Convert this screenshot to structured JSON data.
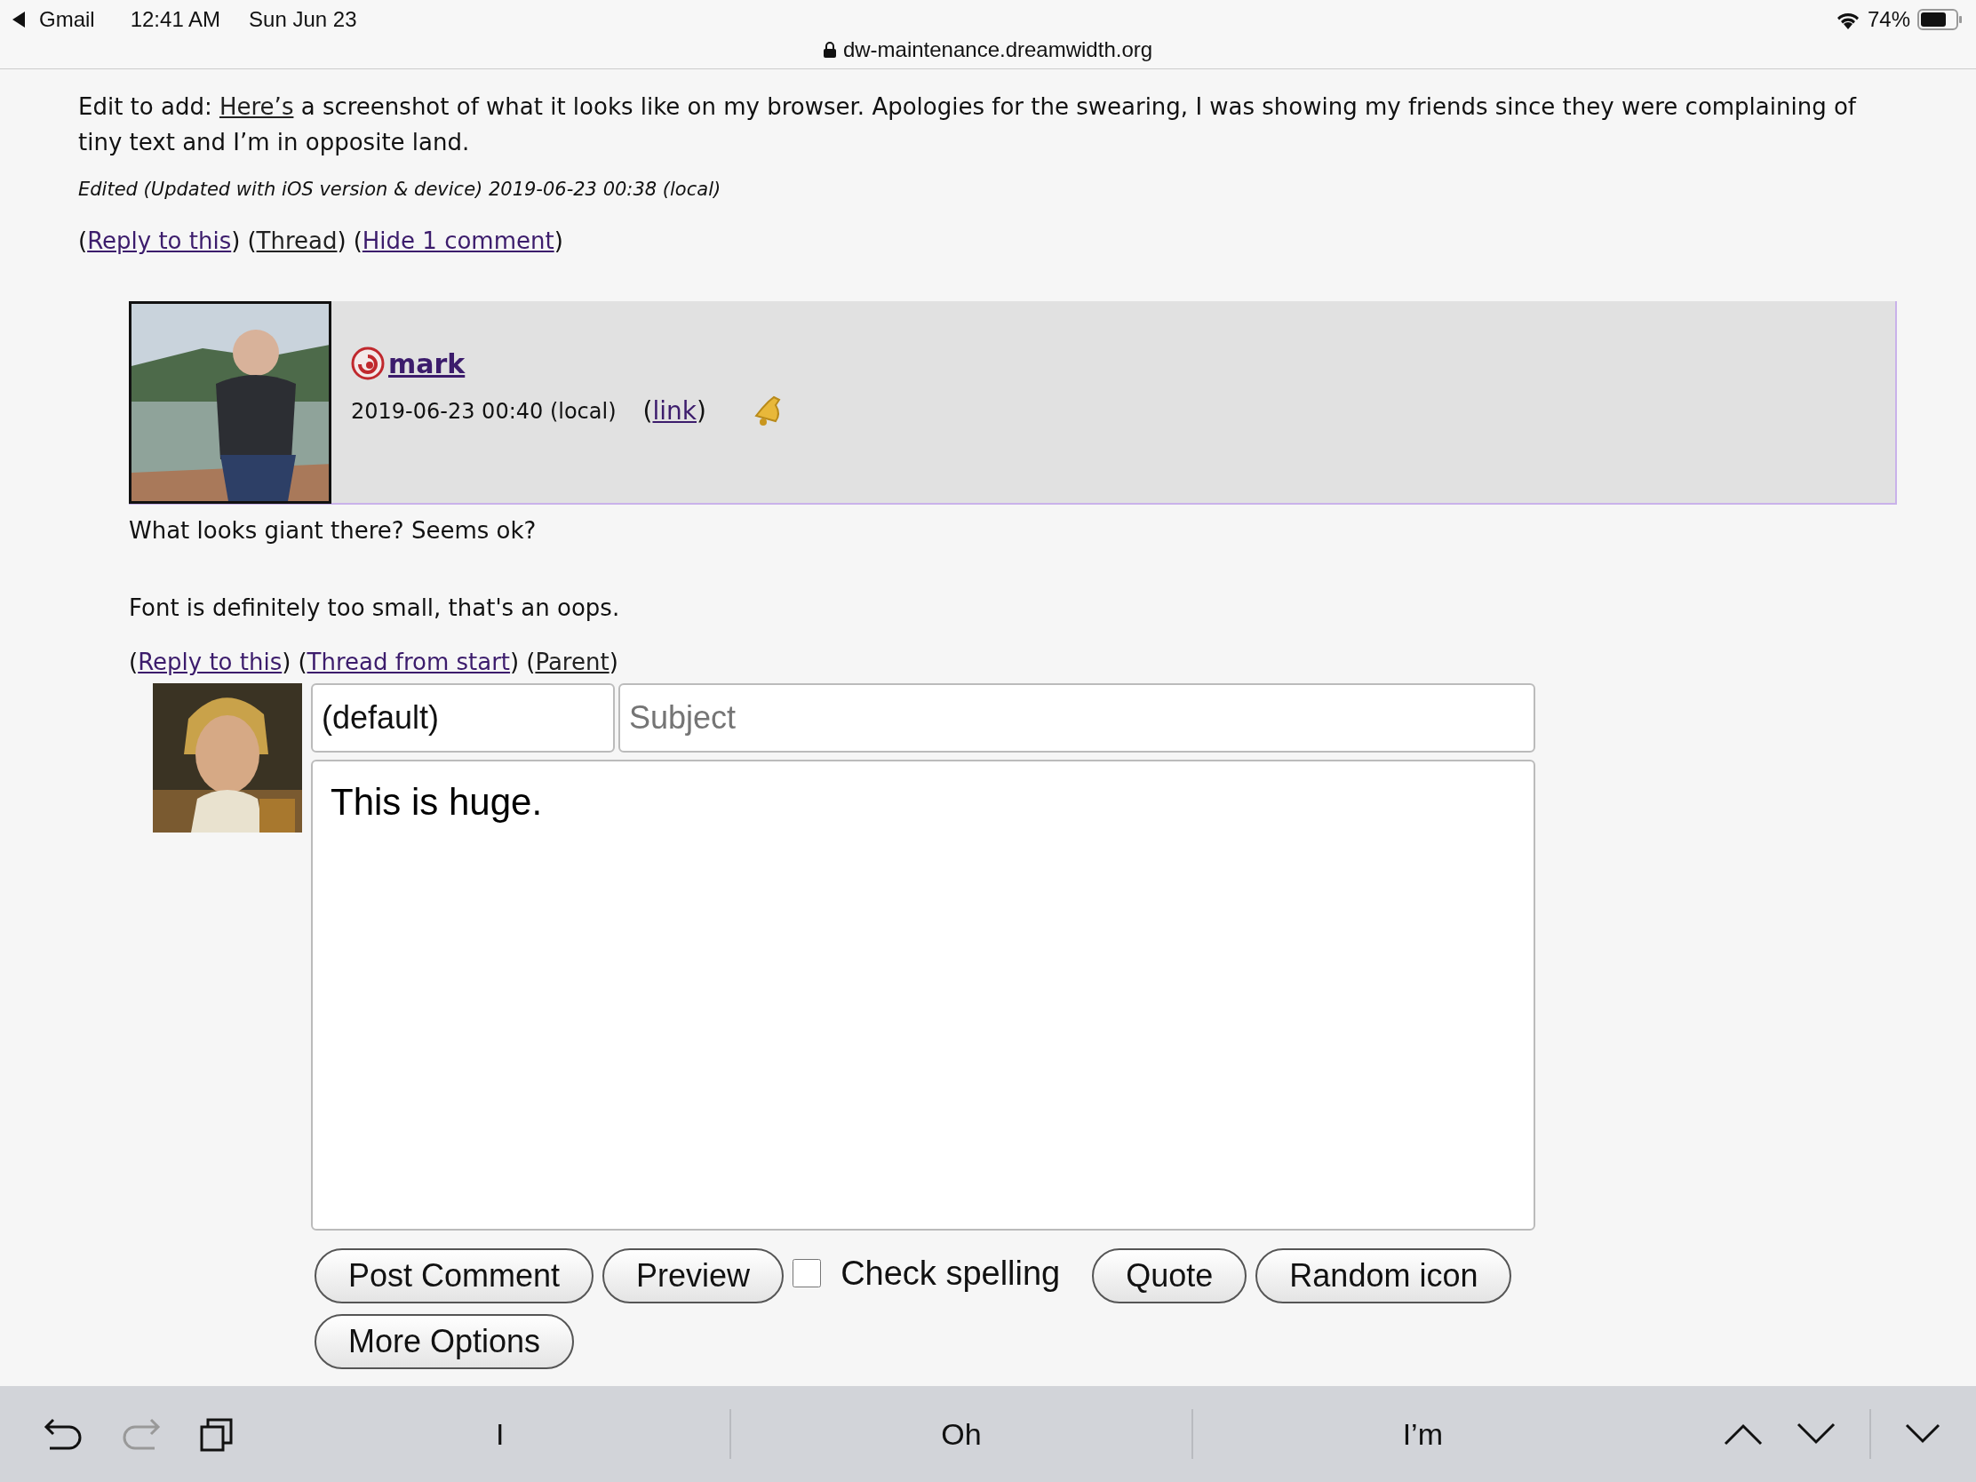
{
  "status_bar": {
    "back_app": "Gmail",
    "time": "12:41 AM",
    "date": "Sun Jun 23",
    "url": "dw-maintenance.dreamwidth.org",
    "battery": "74%"
  },
  "post": {
    "edit_note": {
      "before": "Edit to add: ",
      "link": "Here’s",
      "after": " a screenshot of what it looks like on my browser. Apologies for the swearing, I was showing my friends since they were complaining of tiny text and I’m in opposite land."
    },
    "edited": "Edited (Updated with iOS version & device) 2019-06-23 00:38 (local)",
    "actions": [
      {
        "before": "(",
        "label": "Reply to this",
        "after": ")",
        "visited": false
      },
      {
        "before": "(",
        "label": "Thread",
        "after": ")",
        "visited": true
      },
      {
        "before": "(",
        "label": "Hide 1 comment",
        "after": ")",
        "visited": false
      }
    ]
  },
  "comment": {
    "username": "mark",
    "timestamp": "2019-06-23 00:40 (local)",
    "link": {
      "before": "(",
      "label": "link",
      "after": ")"
    },
    "body": [
      "What looks giant there? Seems ok?",
      "Font is definitely too small, that's an oops."
    ],
    "actions": [
      {
        "before": "(",
        "label": "Reply to this",
        "after": ")",
        "visited": false
      },
      {
        "before": "(",
        "label": "Thread from start",
        "after": ")",
        "visited": false
      },
      {
        "before": "(",
        "label": "Parent",
        "after": ")",
        "visited": true
      }
    ]
  },
  "reply_form": {
    "icon_select": "(default)",
    "subject": {
      "placeholder": "Subject"
    },
    "body": "This is huge.",
    "controls": [
      {
        "kind": "button",
        "label": "Post Comment"
      },
      {
        "kind": "button",
        "label": "Preview"
      },
      {
        "kind": "checkbox",
        "label": "Check spelling",
        "checked": false
      },
      {
        "kind": "button",
        "label": "Quote"
      },
      {
        "kind": "button",
        "label": "Random icon"
      },
      {
        "kind": "button",
        "label": "More Options"
      }
    ]
  },
  "keyboard_bar": {
    "suggestions": [
      "I",
      "Oh",
      "I’m"
    ]
  }
}
